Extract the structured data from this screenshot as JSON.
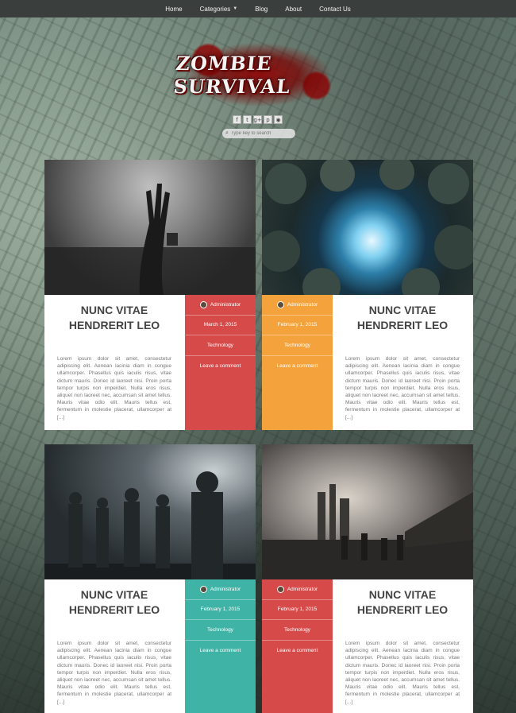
{
  "nav": {
    "items": [
      {
        "label": "Home"
      },
      {
        "label": "Categories",
        "has_dropdown": true
      },
      {
        "label": "Blog"
      },
      {
        "label": "About"
      },
      {
        "label": "Contact Us"
      }
    ]
  },
  "header": {
    "logo_text": "ZOMBIE SURVIVAL",
    "social_icons": [
      "f",
      "t",
      "g+",
      "p",
      "rss"
    ],
    "search_placeholder": "Type key to search"
  },
  "colors": {
    "nav_bg": "#3a3f3d",
    "red": "#d64a4a",
    "orange": "#f4a33c",
    "teal": "#3fb3a6"
  },
  "posts": [
    {
      "title": "NUNC VITAE HENDRERIT LEO",
      "author": "Administrator",
      "date": "March 1, 2015",
      "category": "Technology",
      "comment_link": "Leave a comment",
      "excerpt": "Lorem ipsum dolor sit amet, consectetur adipiscing elit. Aenean lacinia diam in congue ullamcorper. Phasellus quis iaculis risus, vitae dictum mauris. Donec id laoreet nisi. Proin porta tempor turpis non imperdiet. Nulla eros risus, aliquet non laoreet nec, accumsan sit amet tellus. Mauris vitae odio elit. Mauris tellus est, fermentum in molestie placerat, ullamcorper at [...]"
    },
    {
      "title": "NUNC VITAE HENDRERIT LEO",
      "author": "Administrator",
      "date": "February 1, 2015",
      "category": "Technology",
      "comment_link": "Leave a comment",
      "excerpt": "Lorem ipsum dolor sit amet, consectetur adipiscing elit. Aenean lacinia diam in congue ullamcorper. Phasellus quis iaculis risus, vitae dictum mauris. Donec id laoreet nisi. Proin porta tempor turpis non imperdiet. Nulla eros risus, aliquet non laoreet nec, accumsan sit amet tellus. Mauris vitae odio elit. Mauris tellus est, fermentum in molestie placerat, ullamcorper at [...]"
    },
    {
      "title": "NUNC VITAE HENDRERIT LEO",
      "author": "Administrator",
      "date": "February 1, 2015",
      "category": "Technology",
      "comment_link": "Leave a comment",
      "excerpt": "Lorem ipsum dolor sit amet, consectetur adipiscing elit. Aenean lacinia diam in congue ullamcorper. Phasellus quis iaculis risus, vitae dictum mauris. Donec id laoreet nisi. Proin porta tempor turpis non imperdiet. Nulla eros risus, aliquet non laoreet nec, accumsan sit amet tellus. Mauris vitae odio elit. Mauris tellus est, fermentum in molestie placerat, ullamcorper at [...]"
    },
    {
      "title": "NUNC VITAE HENDRERIT LEO",
      "author": "Administrator",
      "date": "February 1, 2015",
      "category": "Technology",
      "comment_link": "Leave a comment",
      "excerpt": "Lorem ipsum dolor sit amet, consectetur adipiscing elit. Aenean lacinia diam in congue ullamcorper. Phasellus quis iaculis risus, vitae dictum mauris. Donec id laoreet nisi. Proin porta tempor turpis non imperdiet. Nulla eros risus, aliquet non laoreet nec, accumsan sit amet tellus. Mauris vitae odio elit. Mauris tellus est, fermentum in molestie placerat, ullamcorper at [...]"
    }
  ]
}
